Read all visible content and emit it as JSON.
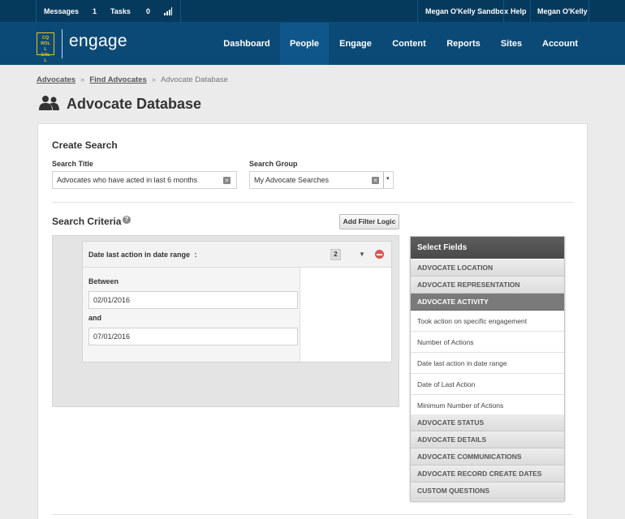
{
  "topbar": {
    "messages_label": "Messages",
    "messages_count": "1",
    "tasks_label": "Tasks",
    "tasks_count": "0",
    "sandbox": "Megan O'Kelly Sandbox",
    "help": "Help",
    "user": "Megan O'Kelly"
  },
  "logo": {
    "mark": "CQ ROLL CALL",
    "text": "engage"
  },
  "nav": [
    {
      "label": "Dashboard"
    },
    {
      "label": "People"
    },
    {
      "label": "Engage"
    },
    {
      "label": "Content"
    },
    {
      "label": "Reports"
    },
    {
      "label": "Sites"
    },
    {
      "label": "Account"
    }
  ],
  "breadcrumb": {
    "item1": "Advocates",
    "item2": "Find Advocates",
    "current": "Advocate Database",
    "separator": "»"
  },
  "page_title": "Advocate Database",
  "create_search": {
    "heading": "Create Search",
    "title_label": "Search Title",
    "title_value": "Advocates who have acted in last 6 months",
    "group_label": "Search Group",
    "group_value": "My Advocate Searches"
  },
  "criteria": {
    "heading": "Search Criteria",
    "add_filter_logic": "Add Filter Logic",
    "filter": {
      "title": "Date last action in date range",
      "colon": ":",
      "badge": "2",
      "between_label": "Between",
      "from_value": "02/01/2016",
      "and_label": "and",
      "to_value": "07/01/2016"
    }
  },
  "select_fields": {
    "heading": "Select Fields",
    "cat_location": "ADVOCATE LOCATION",
    "cat_representation": "ADVOCATE REPRESENTATION",
    "cat_activity": "ADVOCATE ACTIVITY",
    "activity_items": [
      "Took action on specific engagement",
      "Number of Actions",
      "Date last action in date range",
      "Date of Last Action",
      "Minimum Number of Actions"
    ],
    "cat_status": "ADVOCATE STATUS",
    "cat_details": "ADVOCATE DETAILS",
    "cat_communications": "ADVOCATE COMMUNICATIONS",
    "cat_record_dates": "ADVOCATE RECORD CREATE DATES",
    "cat_custom": "CUSTOM QUESTIONS"
  },
  "colors": {
    "topbar": "#063a5d",
    "nav": "#0b4a76",
    "nav_active": "#0f578a",
    "logo_accent": "#e8c21a",
    "remove": "#d9534f"
  }
}
